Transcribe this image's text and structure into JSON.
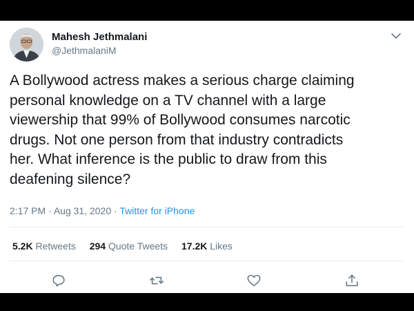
{
  "author": {
    "name": "Mahesh Jethmalani",
    "handle": "@JethmalaniM"
  },
  "tweet": {
    "lines": [
      "A Bollywood actress makes a serious charge claiming",
      "personal knowledge on a TV channel with a large",
      "viewership that 99% of Bollywood consumes narcotic",
      "drugs. Not one person from that industry contradicts",
      "her. What inference is the public to draw from this",
      "deafening silence?"
    ],
    "time": "2:17 PM",
    "date": "Aug 31, 2020",
    "separator": "·",
    "source": "Twitter for iPhone"
  },
  "stats": {
    "retweets_count": "5.2K",
    "retweets_label": "Retweets",
    "quotes_count": "294",
    "quotes_label": "Quote Tweets",
    "likes_count": "17.2K",
    "likes_label": "Likes"
  },
  "icons": {
    "menu": "chevron-down-icon",
    "reply": "reply-icon",
    "retweet": "retweet-icon",
    "like": "heart-icon",
    "share": "share-icon"
  },
  "colors": {
    "text": "#14171a",
    "muted": "#657786",
    "link": "#1b95e0",
    "divider": "#e6ecf0",
    "frame": "#000000"
  }
}
